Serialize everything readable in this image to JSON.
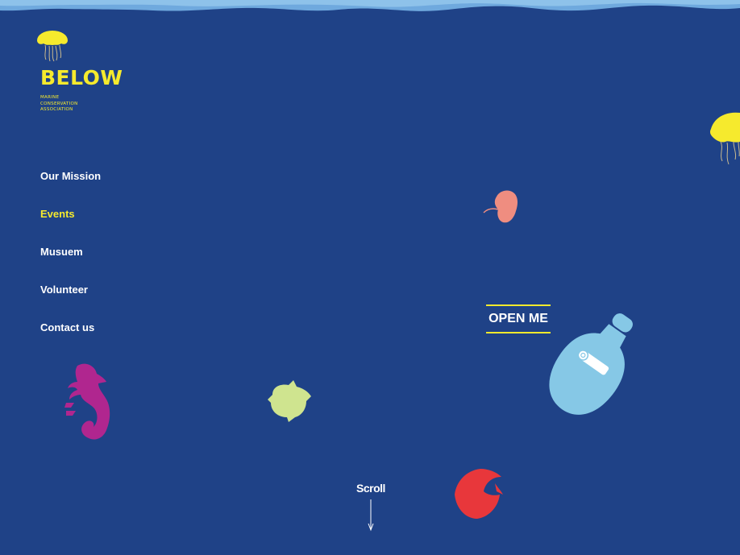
{
  "brand": {
    "name": "BELOW",
    "tagline": [
      "MARINE",
      "CONSERVATION",
      "ASSOCIATION"
    ]
  },
  "nav": {
    "items": [
      {
        "label": "Our Mission",
        "active": false
      },
      {
        "label": "Events",
        "active": true
      },
      {
        "label": "Musuem",
        "active": false
      },
      {
        "label": "Volunteer",
        "active": false
      },
      {
        "label": "Contact us",
        "active": false
      }
    ]
  },
  "cta": {
    "open_label": "OPEN ME"
  },
  "scroll": {
    "label": "Scroll"
  },
  "colors": {
    "background": "#1f4287",
    "accent": "#f6ea2d",
    "seahorse": "#b0268f",
    "turtle": "#cfe48f",
    "bottle": "#86c8e6",
    "fish": "#e8373b",
    "creature_pink": "#ef8d80"
  },
  "icons": [
    "jellyfish-logo-icon",
    "jellyfish-icon",
    "seahorse-icon",
    "turtle-icon",
    "bottle-message-icon",
    "fish-icon",
    "creature-icon",
    "scroll-arrow-icon"
  ]
}
